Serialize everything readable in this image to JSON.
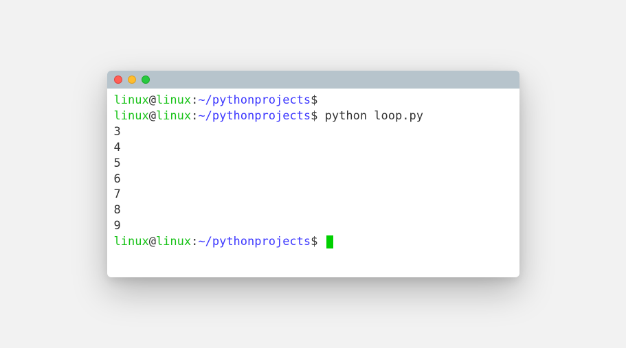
{
  "prompt": {
    "user": "linux",
    "at": "@",
    "host": "linux",
    "colon": ":",
    "path": "~/pythonprojects",
    "dollar": "$"
  },
  "lines": [
    {
      "type": "prompt",
      "command": ""
    },
    {
      "type": "prompt",
      "command": "python loop.py"
    },
    {
      "type": "output",
      "text": "3"
    },
    {
      "type": "output",
      "text": "4"
    },
    {
      "type": "output",
      "text": "5"
    },
    {
      "type": "output",
      "text": "6"
    },
    {
      "type": "output",
      "text": "7"
    },
    {
      "type": "output",
      "text": "8"
    },
    {
      "type": "output",
      "text": "9"
    },
    {
      "type": "prompt",
      "command": "",
      "cursor": true
    }
  ]
}
